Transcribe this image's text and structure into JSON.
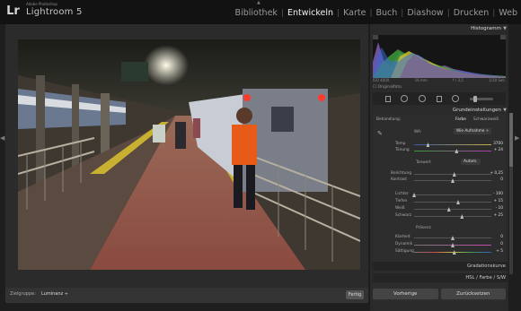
{
  "app": {
    "brand_small": "Adobe Photoshop",
    "brand": "Lightroom 5",
    "logo": "Lr"
  },
  "modules": [
    "Bibliothek",
    "Entwickeln",
    "Karte",
    "Buch",
    "Diashow",
    "Drucken",
    "Web"
  ],
  "active_module": "Entwickeln",
  "toolbar": {
    "zoom_label": "Zielgruppe:",
    "zoom_value": "Luminanz ÷",
    "done": "Fertig"
  },
  "panel": {
    "histogram": "Histogramm",
    "histo_info": [
      "ISO 4000",
      "16 mm",
      "f / 3,5",
      "1/30 Sek."
    ],
    "original": "Originalfoto",
    "grund": "Grundeinstellungen",
    "treatment_label": "Behandlung:",
    "treatment_color": "Farbe",
    "treatment_bw": "Schwarzweiß",
    "wb_label": "WA:",
    "wb_value": "Wie Aufnahme ÷",
    "temp": "Temp",
    "temp_val": "3700",
    "tint": "Tönung",
    "tint_val": "+ 24",
    "tone": "Tonwert",
    "auto": "Autom.",
    "exposure": "Belichtung",
    "exposure_val": "+ 0,25",
    "contrast": "Kontrast",
    "contrast_val": "0",
    "highlights": "Lichter",
    "highlights_val": "- 100",
    "shadows": "Tiefen",
    "shadows_val": "+ 15",
    "whites": "Weiß",
    "whites_val": "- 10",
    "blacks": "Schwarz",
    "blacks_val": "+ 25",
    "presence": "Präsenz",
    "clarity": "Klarheit",
    "clarity_val": "0",
    "vibrance": "Dynamik",
    "vibrance_val": "0",
    "saturation": "Sättigung",
    "saturation_val": "+ 5",
    "tone_curve": "Gradationskurve",
    "hsl": "HSL / Farbe / S/W",
    "prev_btn": "Vorherige",
    "reset_btn": "Zurücksetzen"
  },
  "sliders": {
    "temp": 0.18,
    "tint": 0.55,
    "exposure": 0.52,
    "contrast": 0.5,
    "highlights": 0.0,
    "shadows": 0.57,
    "whites": 0.45,
    "blacks": 0.62,
    "clarity": 0.5,
    "vibrance": 0.5,
    "saturation": 0.52
  }
}
